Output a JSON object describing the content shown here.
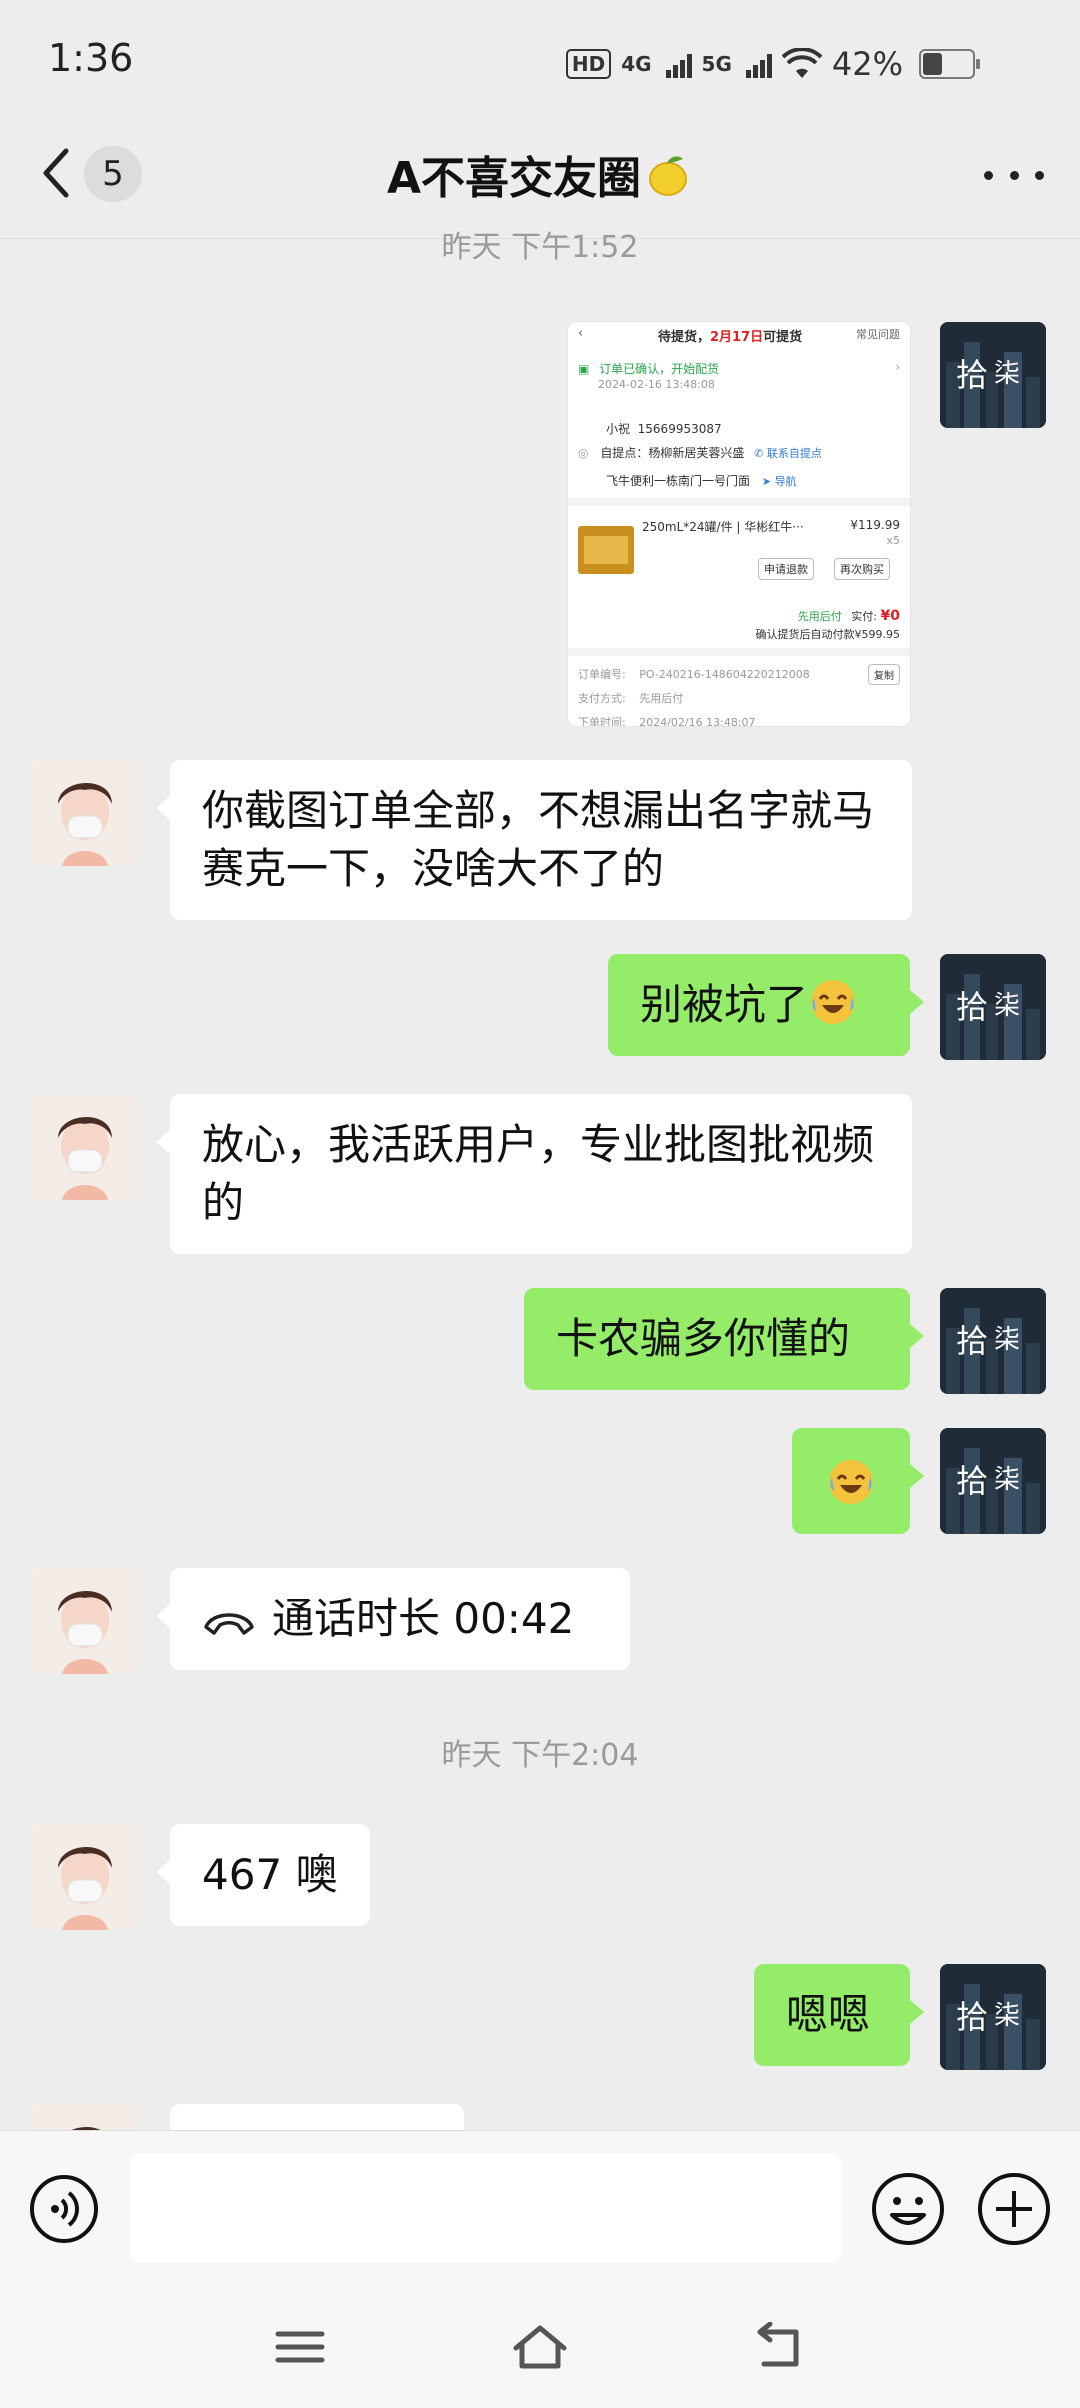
{
  "status_bar": {
    "time": "1:36",
    "hd_label": "HD",
    "net1": "4G",
    "net2": "5G",
    "battery_percent": "42%",
    "battery_level": 0.42
  },
  "header": {
    "unread_count": "5",
    "title": "A不喜交友圈"
  },
  "timestamps": {
    "top_partial": "昨天 下午1:52",
    "mid": "昨天 下午2:04"
  },
  "order_screenshot": {
    "top_title_prefix": "待提货，",
    "top_title_date": "2月17日",
    "top_title_suffix": "可提货",
    "help": "常见问题",
    "status": "订单已确认，开始配货",
    "status_time": "2024-02-16 13:48:08",
    "contact_name": "小祝",
    "contact_phone": "15669953087",
    "pickup_label": "自提点：杨柳新居芙蓉兴盛",
    "pickup_contact": "联系自提点",
    "pickup_address": "飞牛便利一栋南门一号门面",
    "navigate": "导航",
    "product_name": "250mL*24罐/件 | 华彬红牛···",
    "product_price": "¥119.99",
    "product_qty": "x5",
    "refund_button": "申请退款",
    "rebuy_button": "再次购买",
    "pay_later": "先用后付",
    "paid_label": "实付:",
    "paid_amount": "¥0",
    "auto_pay_note": "确认提货后自动付款¥599.95",
    "order_no_label": "订单编号:",
    "order_no": "PO-240216-148604220212008",
    "copy_button": "复制",
    "pay_method_label": "支付方式:",
    "pay_method": "先用后付",
    "order_time_label": "下单时间:",
    "order_time": "2024/02/16 13:48:07"
  },
  "messages": [
    {
      "text": "你截图订单全部，不想漏出名字就马赛克一下，没啥大不了的"
    },
    {
      "text": "别被坑了"
    },
    {
      "text": "放心，我活跃用户，专业批图批视频的"
    },
    {
      "text": "卡农骗多你懂的"
    },
    {
      "text": "通话时长 00:42"
    },
    {
      "text": "467 噢"
    },
    {
      "text": "嗯嗯"
    }
  ],
  "icons": {
    "back": "chevron-left-icon",
    "more": "more-dots-icon",
    "voice": "voice-icon",
    "emoji": "emoji-icon",
    "plus": "plus-icon",
    "call": "phone-icon",
    "menu": "menu-icon",
    "home": "home-icon",
    "back_nav": "back-nav-icon"
  },
  "colors": {
    "sent_bubble": "#95ec69",
    "received_bubble": "#ffffff",
    "background": "#ededed"
  }
}
